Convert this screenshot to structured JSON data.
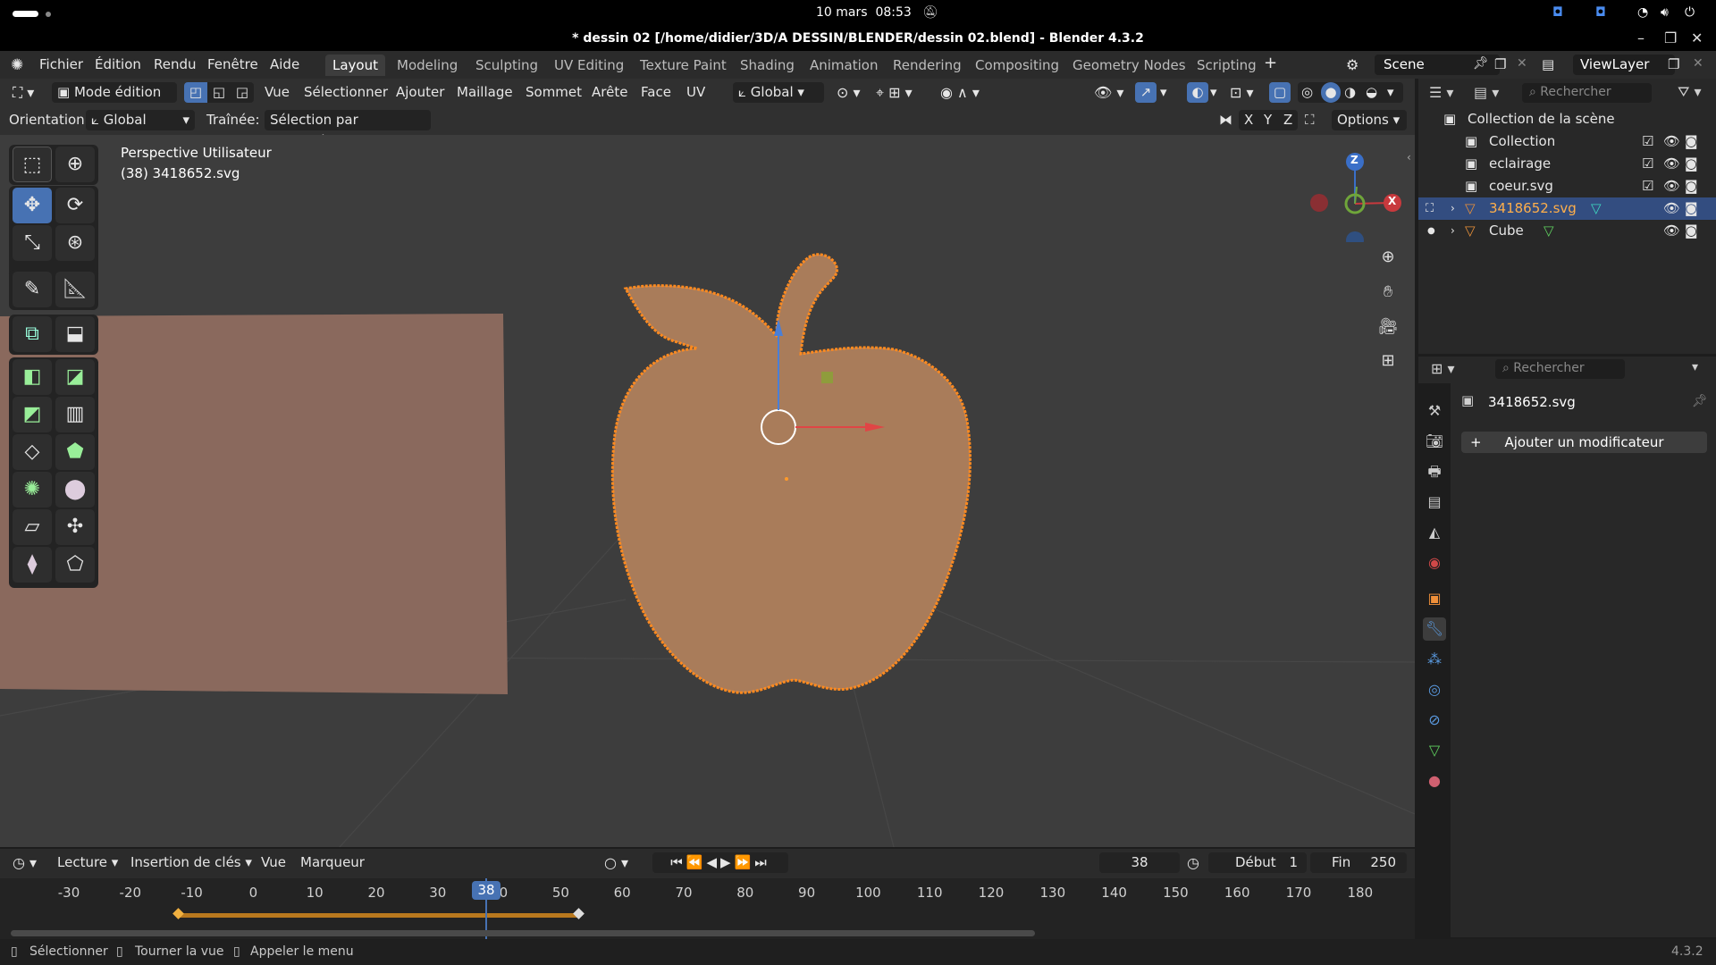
{
  "system": {
    "clock_date": "10 mars",
    "clock_time": "08:53"
  },
  "window": {
    "title": "* dessin 02 [/home/didier/3D/A DESSIN/BLENDER/dessin 02.blend] - Blender 4.3.2"
  },
  "menubar": {
    "file": "Fichier",
    "edit": "Édition",
    "render": "Rendu",
    "window": "Fenêtre",
    "help": "Aide"
  },
  "workspaces": [
    "Layout",
    "Modeling",
    "Sculpting",
    "UV Editing",
    "Texture Paint",
    "Shading",
    "Animation",
    "Rendering",
    "Compositing",
    "Geometry Nodes",
    "Scripting"
  ],
  "scene": {
    "name": "Scene",
    "view_layer": "ViewLayer"
  },
  "viewport_header": {
    "mode": "Mode édition",
    "menus": [
      "Vue",
      "Sélectionner",
      "Ajouter",
      "Maillage",
      "Sommet",
      "Arête",
      "Face",
      "UV"
    ],
    "transform_orientation": "Global"
  },
  "tool_header": {
    "orientation_label": "Orientation:",
    "orientation_value": "Global",
    "drag_label": "Traînée:",
    "drag_value": "Sélection par rectangle",
    "axis_x": "X",
    "axis_y": "Y",
    "axis_z": "Z",
    "options": "Options"
  },
  "viewport": {
    "view_name": "Perspective Utilisateur",
    "object_info": "(38) 3418652.svg",
    "gizmo_z": "Z"
  },
  "outliner": {
    "search_placeholder": "Rechercher",
    "root": "Collection de la scène",
    "items": [
      {
        "name": "Collection"
      },
      {
        "name": "eclairage"
      },
      {
        "name": "coeur.svg"
      },
      {
        "name": "3418652.svg",
        "selected": true
      },
      {
        "name": "Cube"
      }
    ]
  },
  "properties": {
    "search_placeholder": "Rechercher",
    "object_name": "3418652.svg",
    "add_modifier": "Ajouter un modificateur"
  },
  "timeline": {
    "playback": "Lecture",
    "keying": "Insertion de clés",
    "view": "Vue",
    "marker": "Marqueur",
    "current_frame": "38",
    "start_label": "Début",
    "start_value": "1",
    "end_label": "Fin",
    "end_value": "250",
    "ticks": [
      "-30",
      "-20",
      "-10",
      "0",
      "10",
      "20",
      "30",
      "40",
      "50",
      "60",
      "70",
      "80",
      "90",
      "100",
      "110",
      "120",
      "130",
      "140",
      "150",
      "160",
      "170",
      "180"
    ],
    "playhead_label": "38"
  },
  "statusbar": {
    "select": "Sélectionner",
    "rotate": "Tourner la vue",
    "menu": "Appeler le menu",
    "version": "4.3.2"
  }
}
